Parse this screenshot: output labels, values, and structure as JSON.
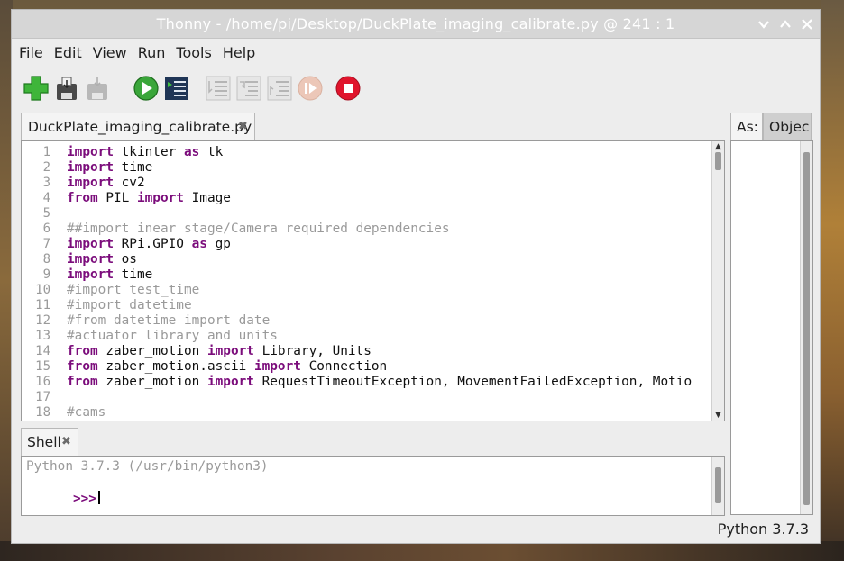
{
  "window": {
    "title": "Thonny  -  /home/pi/Desktop/DuckPlate_imaging_calibrate.py  @  241 : 1",
    "controls": [
      "minimize",
      "maximize",
      "close"
    ]
  },
  "menu": [
    "File",
    "Edit",
    "View",
    "Run",
    "Tools",
    "Help"
  ],
  "toolbar": {
    "buttons": [
      "new-icon",
      "save-icon",
      "save-disabled-icon",
      "run-icon",
      "debug-icon",
      "step-over-icon",
      "step-into-icon",
      "step-out-icon",
      "resume-icon",
      "stop-icon"
    ]
  },
  "editor": {
    "tab_label": "DuckPlate_imaging_calibrate.py",
    "close_glyph": "✖",
    "line_numbers": [
      "1",
      "2",
      "3",
      "4",
      "5",
      "6",
      "7",
      "8",
      "9",
      "10",
      "11",
      "12",
      "13",
      "14",
      "15",
      "16",
      "17",
      "18"
    ],
    "lines": [
      [
        {
          "t": "import",
          "c": "kw"
        },
        {
          "t": " tkinter ",
          "c": ""
        },
        {
          "t": "as",
          "c": "kw"
        },
        {
          "t": " tk",
          "c": ""
        }
      ],
      [
        {
          "t": "import",
          "c": "kw"
        },
        {
          "t": " time",
          "c": ""
        }
      ],
      [
        {
          "t": "import",
          "c": "kw"
        },
        {
          "t": " cv2",
          "c": ""
        }
      ],
      [
        {
          "t": "from",
          "c": "kw"
        },
        {
          "t": " PIL ",
          "c": ""
        },
        {
          "t": "import",
          "c": "kw"
        },
        {
          "t": " Image",
          "c": ""
        }
      ],
      [],
      [
        {
          "t": "##import inear stage/Camera required dependencies",
          "c": "cm"
        }
      ],
      [
        {
          "t": "import",
          "c": "kw"
        },
        {
          "t": " RPi.GPIO ",
          "c": ""
        },
        {
          "t": "as",
          "c": "kw"
        },
        {
          "t": " gp",
          "c": ""
        }
      ],
      [
        {
          "t": "import",
          "c": "kw"
        },
        {
          "t": " os",
          "c": ""
        }
      ],
      [
        {
          "t": "import",
          "c": "kw"
        },
        {
          "t": " time",
          "c": ""
        }
      ],
      [
        {
          "t": "#import test_time",
          "c": "cm"
        }
      ],
      [
        {
          "t": "#import datetime",
          "c": "cm"
        }
      ],
      [
        {
          "t": "#from datetime import date",
          "c": "cm"
        }
      ],
      [
        {
          "t": "#actuator library and units",
          "c": "cm"
        }
      ],
      [
        {
          "t": "from",
          "c": "kw"
        },
        {
          "t": " zaber_motion ",
          "c": ""
        },
        {
          "t": "import",
          "c": "kw"
        },
        {
          "t": " Library, Units",
          "c": ""
        }
      ],
      [
        {
          "t": "from",
          "c": "kw"
        },
        {
          "t": " zaber_motion.ascii ",
          "c": ""
        },
        {
          "t": "import",
          "c": "kw"
        },
        {
          "t": " Connection",
          "c": ""
        }
      ],
      [
        {
          "t": "from",
          "c": "kw"
        },
        {
          "t": " zaber_motion ",
          "c": ""
        },
        {
          "t": "import",
          "c": "kw"
        },
        {
          "t": " RequestTimeoutException, MovementFailedException, Motio",
          "c": ""
        }
      ],
      [],
      [
        {
          "t": "#cams",
          "c": "cm"
        }
      ]
    ]
  },
  "shell": {
    "tab_label": "Shell",
    "close_glyph": "✖",
    "banner": "Python 3.7.3 (/usr/bin/python3)",
    "prompt": ">>>"
  },
  "assistant": {
    "tabs": [
      "As:",
      "Objec"
    ]
  },
  "status": {
    "interpreter": "Python 3.7.3"
  },
  "colors": {
    "keyword": "#7b0c7b",
    "comment": "#9a9a9a",
    "prompt": "#7b0c7b"
  }
}
